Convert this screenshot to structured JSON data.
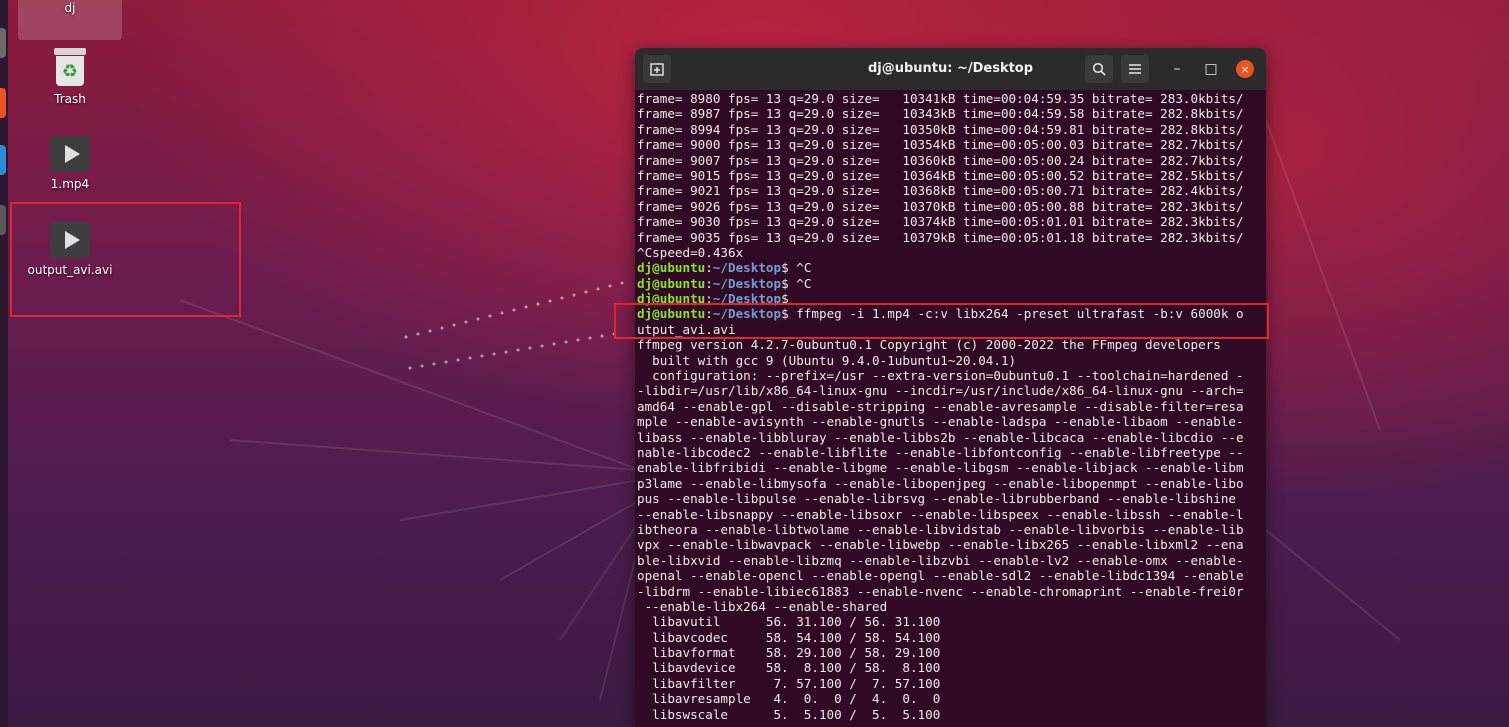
{
  "desktop": {
    "home_label": "dj",
    "icons": [
      {
        "label": "Trash"
      },
      {
        "label": "1.mp4"
      },
      {
        "label": "output_avi.avi"
      }
    ]
  },
  "colors": {
    "highlight": "#e1262b",
    "terminal_bg": "#300a24",
    "prompt_user": "#8ae234",
    "prompt_path": "#729fcf",
    "close_button": "#e95420"
  },
  "terminal": {
    "title": "dj@ubuntu: ~/Desktop",
    "buttons": {
      "new_tab_icon": "new-tab-icon",
      "search_icon": "search-icon",
      "menu_icon": "hamburger-menu-icon",
      "minimize": "–",
      "maximize": "□",
      "close": "×"
    },
    "lines": [
      {
        "type": "out",
        "text": "frame= 8980 fps= 13 q=29.0 size=   10341kB time=00:04:59.35 bitrate= 283.0kbits/"
      },
      {
        "type": "out",
        "text": "frame= 8987 fps= 13 q=29.0 size=   10343kB time=00:04:59.58 bitrate= 282.8kbits/"
      },
      {
        "type": "out",
        "text": "frame= 8994 fps= 13 q=29.0 size=   10350kB time=00:04:59.81 bitrate= 282.8kbits/"
      },
      {
        "type": "out",
        "text": "frame= 9000 fps= 13 q=29.0 size=   10354kB time=00:05:00.03 bitrate= 282.7kbits/"
      },
      {
        "type": "out",
        "text": "frame= 9007 fps= 13 q=29.0 size=   10360kB time=00:05:00.24 bitrate= 282.7kbits/"
      },
      {
        "type": "out",
        "text": "frame= 9015 fps= 13 q=29.0 size=   10364kB time=00:05:00.52 bitrate= 282.5kbits/"
      },
      {
        "type": "out",
        "text": "frame= 9021 fps= 13 q=29.0 size=   10368kB time=00:05:00.71 bitrate= 282.4kbits/"
      },
      {
        "type": "out",
        "text": "frame= 9026 fps= 13 q=29.0 size=   10370kB time=00:05:00.88 bitrate= 282.3kbits/"
      },
      {
        "type": "out",
        "text": "frame= 9030 fps= 13 q=29.0 size=   10374kB time=00:05:01.01 bitrate= 282.3kbits/"
      },
      {
        "type": "out",
        "text": "frame= 9035 fps= 13 q=29.0 size=   10379kB time=00:05:01.18 bitrate= 282.3kbits/"
      },
      {
        "type": "out",
        "text": "^Cspeed=0.436x"
      },
      {
        "type": "prompt",
        "user": "dj@ubuntu",
        "path": "~/Desktop",
        "cmd": "$ ^C"
      },
      {
        "type": "prompt",
        "user": "dj@ubuntu",
        "path": "~/Desktop",
        "cmd": "$ ^C"
      },
      {
        "type": "prompt",
        "user": "dj@ubuntu",
        "path": "~/Desktop",
        "cmd": "$"
      },
      {
        "type": "prompt",
        "user": "dj@ubuntu",
        "path": "~/Desktop",
        "cmd": "$ ffmpeg -i 1.mp4 -c:v libx264 -preset ultrafast -b:v 6000k o"
      },
      {
        "type": "out",
        "text": "utput_avi.avi"
      },
      {
        "type": "out",
        "text": "ffmpeg version 4.2.7-0ubuntu0.1 Copyright (c) 2000-2022 the FFmpeg developers"
      },
      {
        "type": "out",
        "text": "  built with gcc 9 (Ubuntu 9.4.0-1ubuntu1~20.04.1)"
      },
      {
        "type": "out",
        "text": "  configuration: --prefix=/usr --extra-version=0ubuntu0.1 --toolchain=hardened -"
      },
      {
        "type": "out",
        "text": "-libdir=/usr/lib/x86_64-linux-gnu --incdir=/usr/include/x86_64-linux-gnu --arch="
      },
      {
        "type": "out",
        "text": "amd64 --enable-gpl --disable-stripping --enable-avresample --disable-filter=resa"
      },
      {
        "type": "out",
        "text": "mple --enable-avisynth --enable-gnutls --enable-ladspa --enable-libaom --enable-"
      },
      {
        "type": "out",
        "text": "libass --enable-libbluray --enable-libbs2b --enable-libcaca --enable-libcdio --e"
      },
      {
        "type": "out",
        "text": "nable-libcodec2 --enable-libflite --enable-libfontconfig --enable-libfreetype --"
      },
      {
        "type": "out",
        "text": "enable-libfribidi --enable-libgme --enable-libgsm --enable-libjack --enable-libm"
      },
      {
        "type": "out",
        "text": "p3lame --enable-libmysofa --enable-libopenjpeg --enable-libopenmpt --enable-libo"
      },
      {
        "type": "out",
        "text": "pus --enable-libpulse --enable-librsvg --enable-librubberband --enable-libshine "
      },
      {
        "type": "out",
        "text": "--enable-libsnappy --enable-libsoxr --enable-libspeex --enable-libssh --enable-l"
      },
      {
        "type": "out",
        "text": "ibtheora --enable-libtwolame --enable-libvidstab --enable-libvorbis --enable-lib"
      },
      {
        "type": "out",
        "text": "vpx --enable-libwavpack --enable-libwebp --enable-libx265 --enable-libxml2 --ena"
      },
      {
        "type": "out",
        "text": "ble-libxvid --enable-libzmq --enable-libzvbi --enable-lv2 --enable-omx --enable-"
      },
      {
        "type": "out",
        "text": "openal --enable-opencl --enable-opengl --enable-sdl2 --enable-libdc1394 --enable"
      },
      {
        "type": "out",
        "text": "-libdrm --enable-libiec61883 --enable-nvenc --enable-chromaprint --enable-frei0r"
      },
      {
        "type": "out",
        "text": " --enable-libx264 --enable-shared"
      },
      {
        "type": "out",
        "text": "  libavutil      56. 31.100 / 56. 31.100"
      },
      {
        "type": "out",
        "text": "  libavcodec     58. 54.100 / 58. 54.100"
      },
      {
        "type": "out",
        "text": "  libavformat    58. 29.100 / 58. 29.100"
      },
      {
        "type": "out",
        "text": "  libavdevice    58.  8.100 / 58.  8.100"
      },
      {
        "type": "out",
        "text": "  libavfilter     7. 57.100 /  7. 57.100"
      },
      {
        "type": "out",
        "text": "  libavresample   4.  0.  0 /  4.  0.  0"
      },
      {
        "type": "out",
        "text": "  libswscale      5.  5.100 /  5.  5.100"
      }
    ]
  }
}
